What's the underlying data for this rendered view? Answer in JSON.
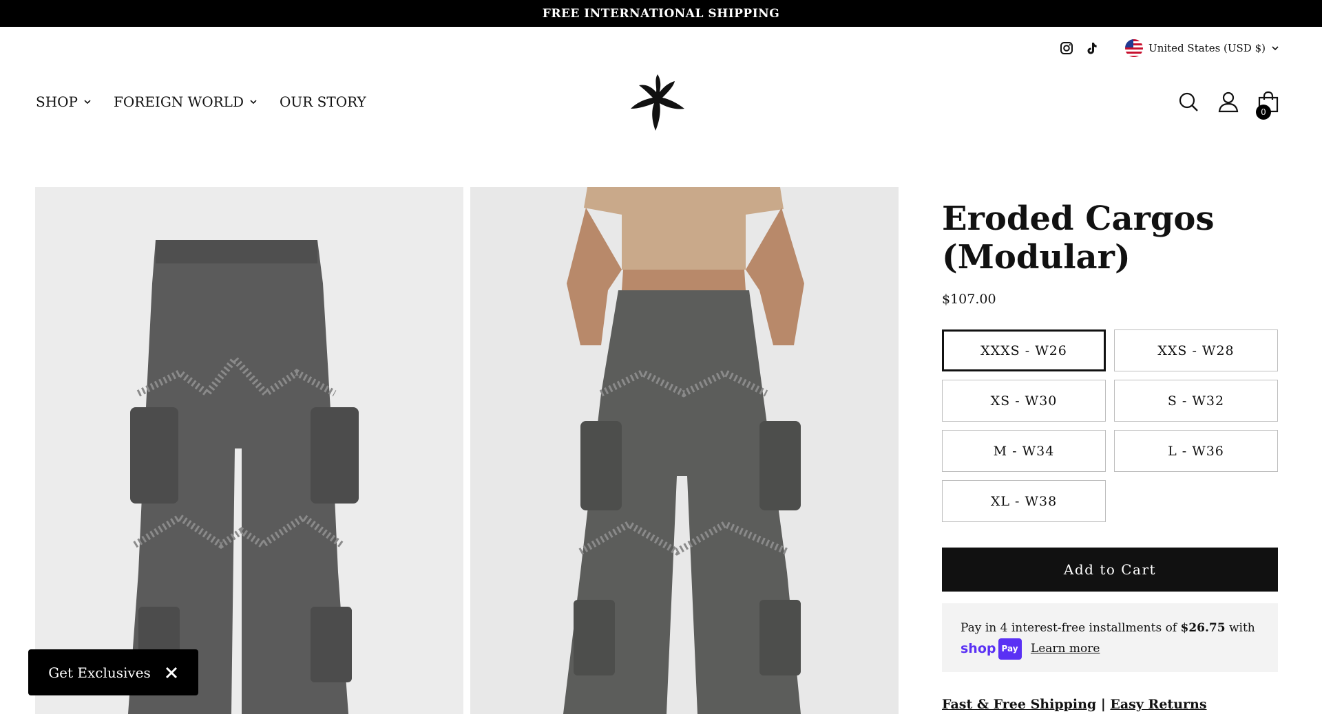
{
  "announcement": "FREE INTERNATIONAL SHIPPING",
  "locale": "United States (USD $)",
  "nav": [
    {
      "label": "SHOP"
    },
    {
      "label": "FOREIGN WORLD"
    },
    {
      "label": "OUR STORY"
    }
  ],
  "cart_count": "0",
  "product": {
    "title": "Eroded Cargos (Modular)",
    "price": "$107.00",
    "sizes": [
      "XXXS - W26",
      "XXS - W28",
      "XS - W30",
      "S - W32",
      "M - W34",
      "L - W36",
      "XL - W38"
    ],
    "selected_size": "XXXS - W26",
    "add_to_cart": "Add to Cart"
  },
  "shoppay": {
    "text_before": "Pay in 4 interest-free installments of",
    "amount": "$26.75",
    "text_after": "with",
    "brand_word": "shop",
    "brand_pay": "Pay",
    "learn_more": "Learn more"
  },
  "links": {
    "shipping": "Fast & Free Shipping",
    "sep": "|",
    "returns": "Easy Returns"
  },
  "popup": {
    "label": "Get Exclusives"
  },
  "colors": {
    "accent": "#111111",
    "shoppay": "#5a31f4",
    "announce_bg": "#000000"
  },
  "icons": [
    "instagram-icon",
    "tiktok-icon",
    "search-icon",
    "account-icon",
    "cart-icon",
    "close-icon",
    "chevron-down-icon"
  ]
}
